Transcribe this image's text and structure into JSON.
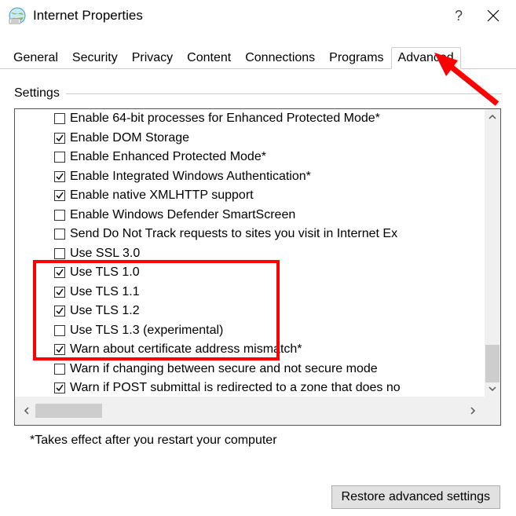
{
  "window": {
    "title": "Internet Properties",
    "help_symbol": "?",
    "close_symbol": "×"
  },
  "tabs": {
    "items": [
      {
        "label": "General",
        "active": false
      },
      {
        "label": "Security",
        "active": false
      },
      {
        "label": "Privacy",
        "active": false
      },
      {
        "label": "Content",
        "active": false
      },
      {
        "label": "Connections",
        "active": false
      },
      {
        "label": "Programs",
        "active": false
      },
      {
        "label": "Advanced",
        "active": true
      }
    ]
  },
  "section": {
    "title": "Settings"
  },
  "settings": {
    "options": [
      {
        "label": "Enable 64-bit processes for Enhanced Protected Mode*",
        "checked": false
      },
      {
        "label": "Enable DOM Storage",
        "checked": true
      },
      {
        "label": "Enable Enhanced Protected Mode*",
        "checked": false
      },
      {
        "label": "Enable Integrated Windows Authentication*",
        "checked": true
      },
      {
        "label": "Enable native XMLHTTP support",
        "checked": true
      },
      {
        "label": "Enable Windows Defender SmartScreen",
        "checked": false
      },
      {
        "label": "Send Do Not Track requests to sites you visit in Internet Ex",
        "checked": false
      },
      {
        "label": "Use SSL 3.0",
        "checked": false
      },
      {
        "label": "Use TLS 1.0",
        "checked": true
      },
      {
        "label": "Use TLS 1.1",
        "checked": true
      },
      {
        "label": "Use TLS 1.2",
        "checked": true
      },
      {
        "label": "Use TLS 1.3 (experimental)",
        "checked": false
      },
      {
        "label": "Warn about certificate address mismatch*",
        "checked": true
      },
      {
        "label": "Warn if changing between secure and not secure mode",
        "checked": false
      },
      {
        "label": "Warn if POST submittal is redirected to a zone that does no",
        "checked": true
      }
    ]
  },
  "footnote": "*Takes effect after you restart your computer",
  "buttons": {
    "restore_label": "Restore advanced settings"
  }
}
